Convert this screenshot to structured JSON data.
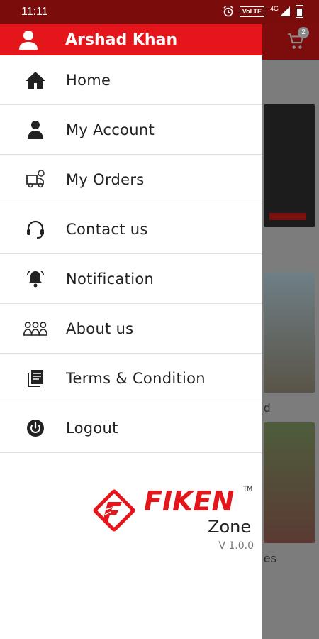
{
  "status_bar": {
    "time": "11:11",
    "network_label": "VoLTE",
    "signal_label": "4G"
  },
  "user": {
    "name": "Arshad Khan"
  },
  "menu": {
    "items": [
      {
        "label": "Home",
        "icon": "home-icon"
      },
      {
        "label": "My Account",
        "icon": "person-icon"
      },
      {
        "label": "My Orders",
        "icon": "orders-icon"
      },
      {
        "label": "Contact us",
        "icon": "headset-icon"
      },
      {
        "label": "Notification",
        "icon": "bell-icon"
      },
      {
        "label": "About us",
        "icon": "group-icon"
      },
      {
        "label": "Terms & Condition",
        "icon": "terms-icon"
      },
      {
        "label": "Logout",
        "icon": "power-icon"
      }
    ]
  },
  "brand": {
    "name_top": "FIKEN",
    "name_bottom": "Zone",
    "trademark": "TM",
    "version": "V 1.0.0"
  },
  "background": {
    "cart_count": "2",
    "peek_text_1": "d",
    "peek_text_2": "es"
  },
  "colors": {
    "accent": "#e4161c",
    "status_bar": "#7a0c0c"
  }
}
